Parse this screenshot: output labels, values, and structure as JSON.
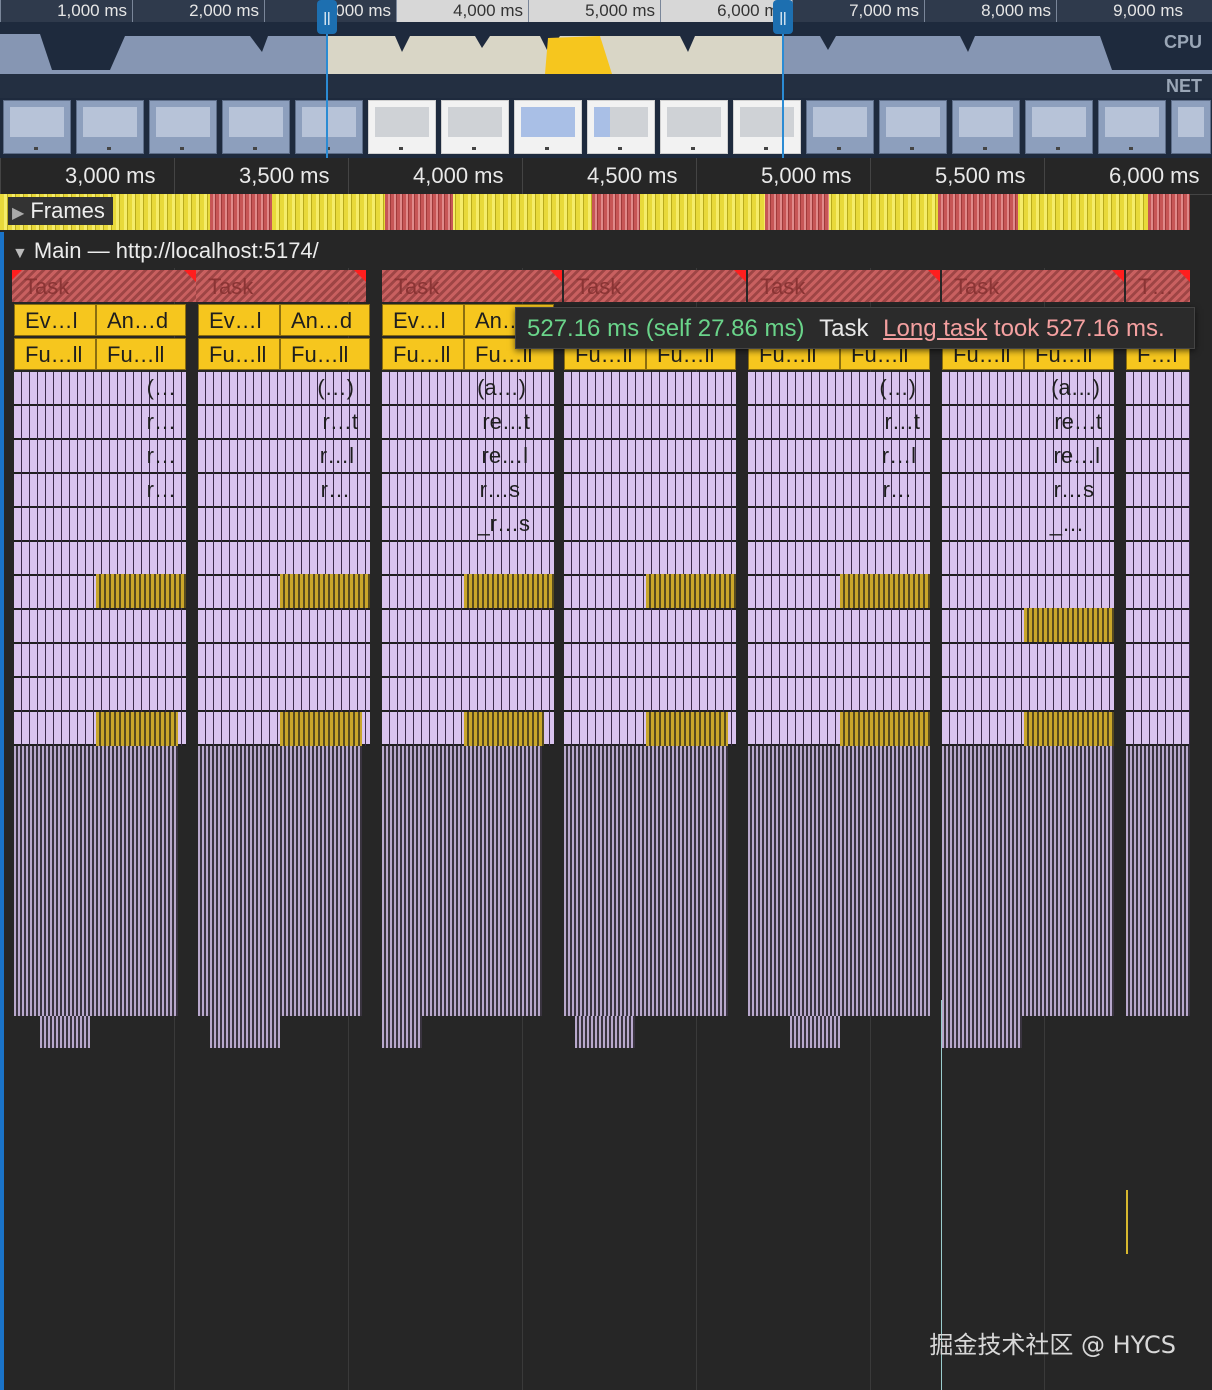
{
  "overview": {
    "ticks": [
      "1,000 ms",
      "2,000 ms",
      "3,000 ms",
      "4,000 ms",
      "5,000 ms",
      "6,000 ms",
      "7,000 ms",
      "8,000 ms",
      "9,000 ms"
    ],
    "cpu_label": "CPU",
    "net_label": "NET",
    "handle_grip": "||"
  },
  "ruler": {
    "ticks": [
      "3,000 ms",
      "3,500 ms",
      "4,000 ms",
      "4,500 ms",
      "5,000 ms",
      "5,500 ms",
      "6,000 ms"
    ]
  },
  "frames": {
    "label": "Frames"
  },
  "main": {
    "title": "Main — http://localhost:5174/"
  },
  "tasks": [
    {
      "label": "Task",
      "ev": "Ev…l",
      "an": "An…d",
      "fu1": "Fu…ll",
      "fu2": "Fu…ll",
      "rows": [
        "(…",
        "r…",
        "r…",
        "r…"
      ]
    },
    {
      "label": "Task",
      "ev": "Ev…l",
      "an": "An…d",
      "fu1": "Fu…ll",
      "fu2": "Fu…ll",
      "rows": [
        "(…)",
        "r…t",
        "r…l",
        "r…"
      ]
    },
    {
      "label": "Task",
      "ev": "Ev…l",
      "an": "An…",
      "fu1": "Fu…ll",
      "fu2": "Fu…ll",
      "rows": [
        "(a…)",
        "re…t",
        "re…l",
        "r…s",
        "_r…s"
      ]
    },
    {
      "label": "Task",
      "ev": "",
      "an": "",
      "fu1": "Fu…ll",
      "fu2": "Fu…ll",
      "rows": []
    },
    {
      "label": "Task",
      "ev": "",
      "an": "",
      "fu1": "Fu…ll",
      "fu2": "Fu…ll",
      "rows": [
        "(…)",
        "r…t",
        "r…l",
        "r…"
      ]
    },
    {
      "label": "Task",
      "ev": "",
      "an": "",
      "fu1": "Fu…ll",
      "fu2": "Fu…ll",
      "rows": [
        "(a…)",
        "re…t",
        "re…l",
        "r…s",
        "_…"
      ]
    },
    {
      "label": "T…",
      "ev": "",
      "an": "",
      "fu1": "F…l",
      "fu2": "",
      "rows": []
    }
  ],
  "tooltip": {
    "duration": "527.16 ms (self 27.86 ms)",
    "name": "Task",
    "warning_link": "Long task",
    "warning_rest": "took 527.16 ms."
  },
  "watermark": "掘金技术社区 @ HYCS",
  "colors": {
    "task": "#c96060",
    "scripting": "#f6c61e",
    "function": "#d9c3ee",
    "selection": "#2b8bd3"
  }
}
